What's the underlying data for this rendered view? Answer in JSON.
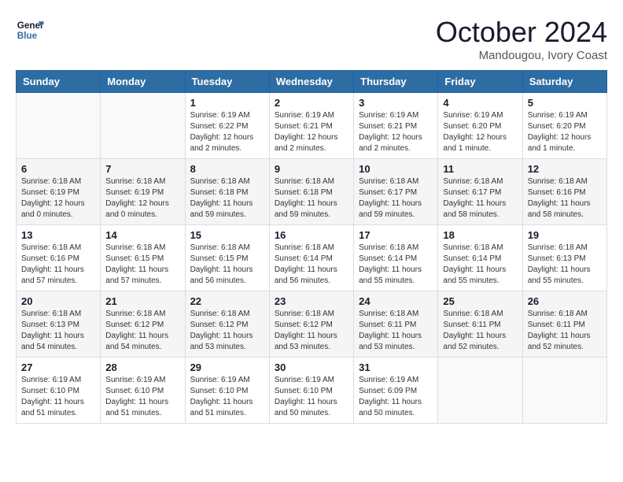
{
  "header": {
    "logo_line1": "General",
    "logo_line2": "Blue",
    "month": "October 2024",
    "location": "Mandougou, Ivory Coast"
  },
  "weekdays": [
    "Sunday",
    "Monday",
    "Tuesday",
    "Wednesday",
    "Thursday",
    "Friday",
    "Saturday"
  ],
  "weeks": [
    [
      {
        "day": "",
        "info": ""
      },
      {
        "day": "",
        "info": ""
      },
      {
        "day": "1",
        "info": "Sunrise: 6:19 AM\nSunset: 6:22 PM\nDaylight: 12 hours and 2 minutes."
      },
      {
        "day": "2",
        "info": "Sunrise: 6:19 AM\nSunset: 6:21 PM\nDaylight: 12 hours and 2 minutes."
      },
      {
        "day": "3",
        "info": "Sunrise: 6:19 AM\nSunset: 6:21 PM\nDaylight: 12 hours and 2 minutes."
      },
      {
        "day": "4",
        "info": "Sunrise: 6:19 AM\nSunset: 6:20 PM\nDaylight: 12 hours and 1 minute."
      },
      {
        "day": "5",
        "info": "Sunrise: 6:19 AM\nSunset: 6:20 PM\nDaylight: 12 hours and 1 minute."
      }
    ],
    [
      {
        "day": "6",
        "info": "Sunrise: 6:18 AM\nSunset: 6:19 PM\nDaylight: 12 hours and 0 minutes."
      },
      {
        "day": "7",
        "info": "Sunrise: 6:18 AM\nSunset: 6:19 PM\nDaylight: 12 hours and 0 minutes."
      },
      {
        "day": "8",
        "info": "Sunrise: 6:18 AM\nSunset: 6:18 PM\nDaylight: 11 hours and 59 minutes."
      },
      {
        "day": "9",
        "info": "Sunrise: 6:18 AM\nSunset: 6:18 PM\nDaylight: 11 hours and 59 minutes."
      },
      {
        "day": "10",
        "info": "Sunrise: 6:18 AM\nSunset: 6:17 PM\nDaylight: 11 hours and 59 minutes."
      },
      {
        "day": "11",
        "info": "Sunrise: 6:18 AM\nSunset: 6:17 PM\nDaylight: 11 hours and 58 minutes."
      },
      {
        "day": "12",
        "info": "Sunrise: 6:18 AM\nSunset: 6:16 PM\nDaylight: 11 hours and 58 minutes."
      }
    ],
    [
      {
        "day": "13",
        "info": "Sunrise: 6:18 AM\nSunset: 6:16 PM\nDaylight: 11 hours and 57 minutes."
      },
      {
        "day": "14",
        "info": "Sunrise: 6:18 AM\nSunset: 6:15 PM\nDaylight: 11 hours and 57 minutes."
      },
      {
        "day": "15",
        "info": "Sunrise: 6:18 AM\nSunset: 6:15 PM\nDaylight: 11 hours and 56 minutes."
      },
      {
        "day": "16",
        "info": "Sunrise: 6:18 AM\nSunset: 6:14 PM\nDaylight: 11 hours and 56 minutes."
      },
      {
        "day": "17",
        "info": "Sunrise: 6:18 AM\nSunset: 6:14 PM\nDaylight: 11 hours and 55 minutes."
      },
      {
        "day": "18",
        "info": "Sunrise: 6:18 AM\nSunset: 6:14 PM\nDaylight: 11 hours and 55 minutes."
      },
      {
        "day": "19",
        "info": "Sunrise: 6:18 AM\nSunset: 6:13 PM\nDaylight: 11 hours and 55 minutes."
      }
    ],
    [
      {
        "day": "20",
        "info": "Sunrise: 6:18 AM\nSunset: 6:13 PM\nDaylight: 11 hours and 54 minutes."
      },
      {
        "day": "21",
        "info": "Sunrise: 6:18 AM\nSunset: 6:12 PM\nDaylight: 11 hours and 54 minutes."
      },
      {
        "day": "22",
        "info": "Sunrise: 6:18 AM\nSunset: 6:12 PM\nDaylight: 11 hours and 53 minutes."
      },
      {
        "day": "23",
        "info": "Sunrise: 6:18 AM\nSunset: 6:12 PM\nDaylight: 11 hours and 53 minutes."
      },
      {
        "day": "24",
        "info": "Sunrise: 6:18 AM\nSunset: 6:11 PM\nDaylight: 11 hours and 53 minutes."
      },
      {
        "day": "25",
        "info": "Sunrise: 6:18 AM\nSunset: 6:11 PM\nDaylight: 11 hours and 52 minutes."
      },
      {
        "day": "26",
        "info": "Sunrise: 6:18 AM\nSunset: 6:11 PM\nDaylight: 11 hours and 52 minutes."
      }
    ],
    [
      {
        "day": "27",
        "info": "Sunrise: 6:19 AM\nSunset: 6:10 PM\nDaylight: 11 hours and 51 minutes."
      },
      {
        "day": "28",
        "info": "Sunrise: 6:19 AM\nSunset: 6:10 PM\nDaylight: 11 hours and 51 minutes."
      },
      {
        "day": "29",
        "info": "Sunrise: 6:19 AM\nSunset: 6:10 PM\nDaylight: 11 hours and 51 minutes."
      },
      {
        "day": "30",
        "info": "Sunrise: 6:19 AM\nSunset: 6:10 PM\nDaylight: 11 hours and 50 minutes."
      },
      {
        "day": "31",
        "info": "Sunrise: 6:19 AM\nSunset: 6:09 PM\nDaylight: 11 hours and 50 minutes."
      },
      {
        "day": "",
        "info": ""
      },
      {
        "day": "",
        "info": ""
      }
    ]
  ]
}
